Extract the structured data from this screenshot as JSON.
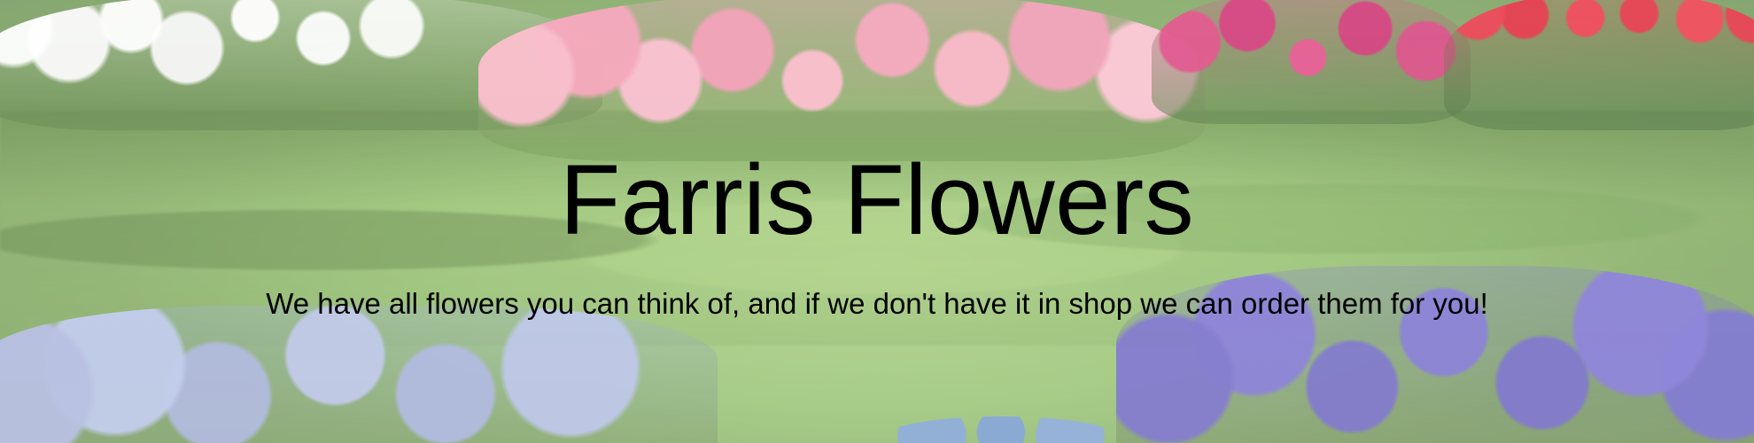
{
  "hero": {
    "title": "Farris Flowers",
    "tagline": "We have all flowers you can think of, and if we don't have it in shop we can order them for you!"
  },
  "theme": {
    "text_color": "#000000",
    "grass_color": "#88ba5f",
    "pink_flower_color": "#f2a0b8",
    "purple_flower_color": "#746bd0"
  }
}
